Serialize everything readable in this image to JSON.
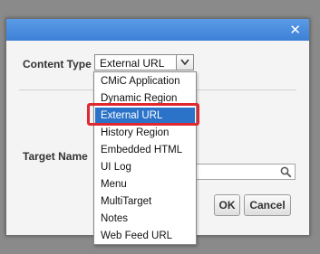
{
  "dialog": {
    "close_glyph": "✕",
    "content_type_label": "Content Type",
    "content_type_value": "External URL",
    "hidden_partial": "C",
    "target_name_label": "Target Name",
    "target_name_value": "",
    "ok_label": "OK",
    "cancel_label": "Cancel"
  },
  "dropdown": {
    "options": [
      "CMiC Application",
      "Dynamic Region",
      "External URL",
      "History Region",
      "Embedded HTML",
      "UI Log",
      "Menu",
      "MultiTarget",
      "Notes",
      "Web Feed URL"
    ],
    "selected": "External URL"
  },
  "colors": {
    "titlebar": "#3c80d6",
    "selection": "#2b73c8",
    "highlight_box": "#e0282f"
  }
}
